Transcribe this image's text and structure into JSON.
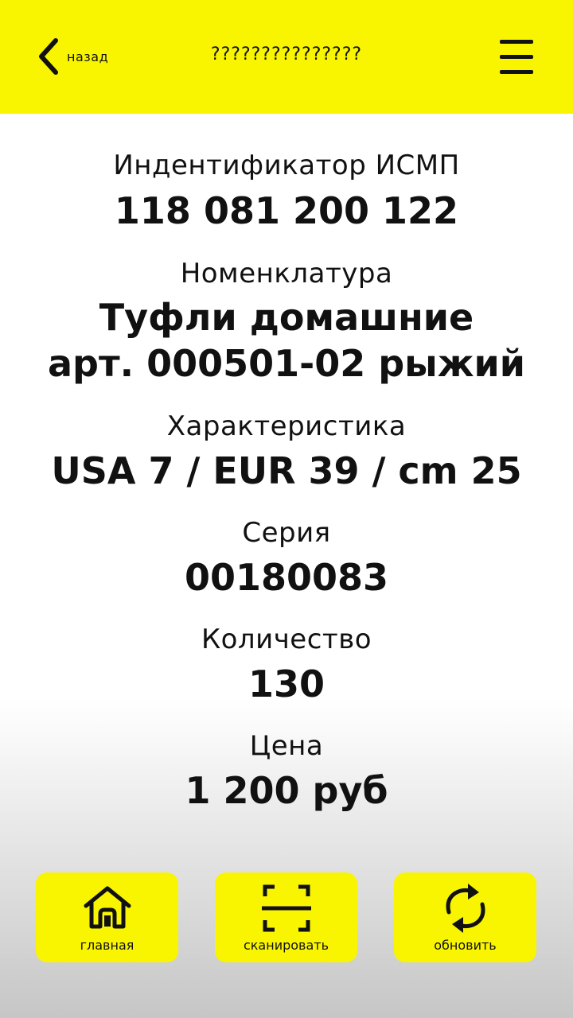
{
  "header": {
    "back_label": "назад",
    "title": "???????????????",
    "back_icon": "chevron-left-icon",
    "menu_icon": "hamburger-menu-icon",
    "background_color": "#f9f500"
  },
  "fields": [
    {
      "label": "Индентификатор ИСМП",
      "value": "118 081 200 122"
    },
    {
      "label": "Номенклатура",
      "value_lines": [
        "Туфли домашние",
        "арт. 000501-02 рыжий"
      ]
    },
    {
      "label": "Характеристика",
      "value": "USA 7 / EUR 39 / cm 25"
    },
    {
      "label": "Серия",
      "value": "00180083"
    },
    {
      "label": "Количество",
      "value": "130"
    },
    {
      "label": "Цена",
      "value": "1 200 руб"
    }
  ],
  "bottom_nav": [
    {
      "label": "главная",
      "icon": "home-icon"
    },
    {
      "label": "сканировать",
      "icon": "scan-icon"
    },
    {
      "label": "обновить",
      "icon": "refresh-icon"
    }
  ]
}
